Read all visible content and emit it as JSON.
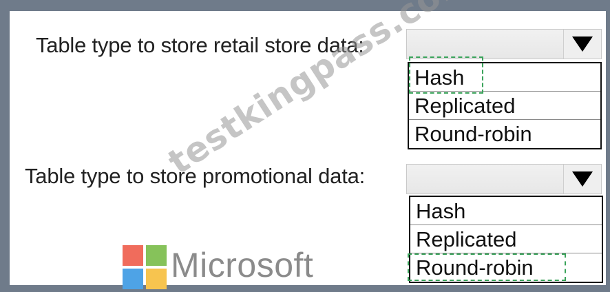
{
  "questions": [
    {
      "label": "Table type to store retail store data:",
      "selected_value": "",
      "options": [
        "Hash",
        "Replicated",
        "Round-robin"
      ]
    },
    {
      "label": "Table type to store promotional data:",
      "selected_value": "",
      "options": [
        "Hash",
        "Replicated",
        "Round-robin"
      ]
    }
  ],
  "branding": {
    "logo_text": "Microsoft",
    "logo_colors": [
      "#f06c5c",
      "#86c25a",
      "#4ea3e6",
      "#f7c44f"
    ]
  },
  "watermark": "testkingpass.com",
  "icons": {
    "dropdown": "triangle-down-icon"
  },
  "colors": {
    "frame": "#6f7b8a",
    "selection_dash": "#3aa35a"
  }
}
